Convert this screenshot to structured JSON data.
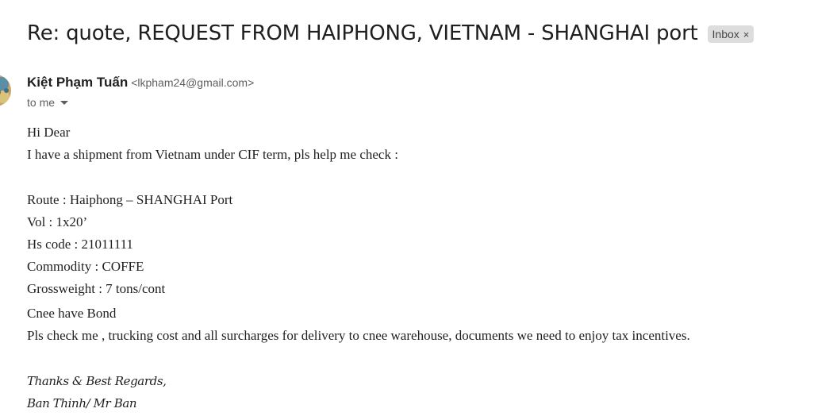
{
  "subject": "Re: quote, REQUEST FROM HAIPHONG, VIETNAM - SHANGHAI port",
  "label": {
    "name": "Inbox",
    "remove_glyph": "×"
  },
  "sender": {
    "name": "Kiệt Phạm Tuấn",
    "email": "<lkpham24@gmail.com>",
    "avatar_icon": "avatar-icon"
  },
  "recipient": {
    "text": "to me",
    "caret_icon": "caret-down-icon"
  },
  "body": {
    "greeting": "Hi Dear",
    "intro": "I have a shipment from Vietnam under CIF term, pls help me check :",
    "route": "Route : Haiphong – SHANGHAI Port",
    "vol": "Vol : 1x20’",
    "hs_code": "Hs code : 21011111",
    "commodity": "Commodity :  COFFE",
    "grossweight": "Grossweight : 7 tons/cont",
    "cnee": "Cnee  have Bond",
    "request": "Pls check me , trucking cost and all surcharges for delivery to cnee warehouse, documents we need to enjoy tax incentives."
  },
  "signature": {
    "closing": "Thanks & Best Regards,",
    "name": "Ban Thinh/ Mr Ban"
  },
  "colors": {
    "text": "#1f1f1f",
    "muted": "#5e5e5e",
    "chip_bg": "#dddddd"
  }
}
